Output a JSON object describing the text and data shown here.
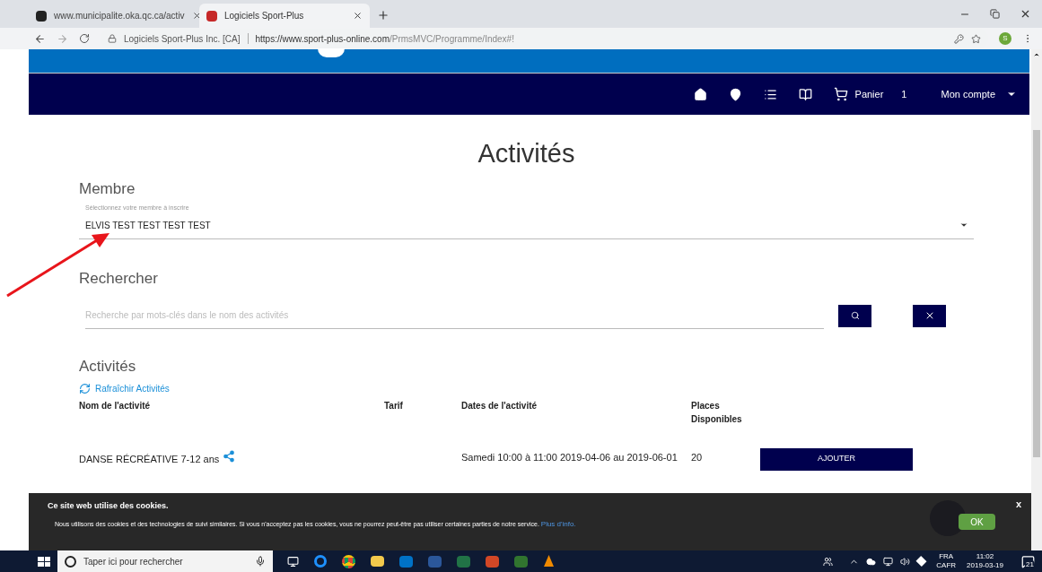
{
  "browser": {
    "tabs": [
      {
        "title": "www.municipalite.oka.qc.ca/activ",
        "selected": false
      },
      {
        "title": "Logiciels Sport-Plus",
        "selected": true
      }
    ],
    "site_identity": "Logiciels Sport-Plus Inc. [CA]",
    "url_host": "https://www.sport-plus-online.com",
    "url_path": "/PrmsMVC/Programme/Index#!",
    "profile_initial": "S"
  },
  "nav": {
    "cart_label": "Panier",
    "cart_count": "1",
    "account_label": "Mon compte"
  },
  "page_title": "Activités",
  "member": {
    "heading": "Membre",
    "label": "Sélectionnez votre membre à inscrire",
    "value": "ELVIS TEST TEST TEST TEST"
  },
  "search": {
    "heading": "Rechercher",
    "placeholder": "Recherche par mots-clés dans le nom des activités"
  },
  "activities": {
    "heading": "Activités",
    "refresh_link": "Rafraîchir Activités",
    "columns": [
      "Nom de l'activité",
      "Tarif",
      "Dates de l'activité",
      "Places Disponibles"
    ],
    "rows": [
      {
        "name": "DANSE RÉCRÉATIVE 7-12 ans",
        "dates": "Samedi 10:00 à 11:00 2019-04-06 au 2019-06-01",
        "places": "20",
        "button": "AJOUTER"
      }
    ]
  },
  "cookie_banner": {
    "title": "Ce site web utilise des cookies.",
    "text": "Nous utilisons des cookies et des technologies de suivi similaires. Si vous n'acceptez pas les cookies, vous ne pourrez peut-être pas utiliser certaines parties de notre service.",
    "link": "Plus d'info.",
    "close": "x",
    "ok": "OK"
  },
  "taskbar": {
    "search_placeholder": "Taper ici pour rechercher",
    "language": "FRA",
    "layout": "CAFR",
    "time": "11:02",
    "date": "2019-03-19",
    "notifications": "21"
  }
}
